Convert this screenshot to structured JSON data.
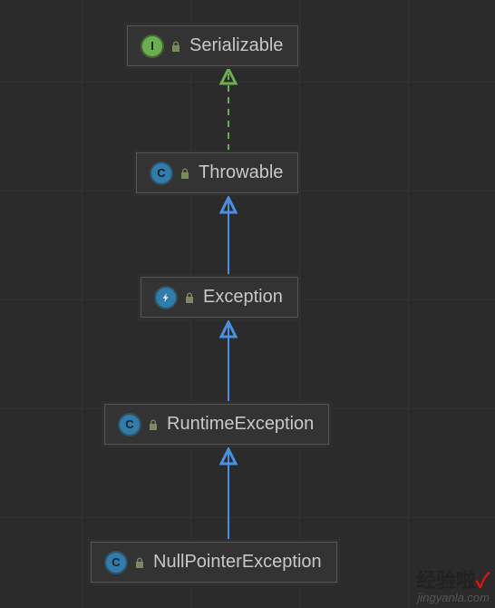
{
  "diagram": {
    "nodes": {
      "serializable": {
        "type": "interface",
        "letter": "I",
        "lock": true,
        "label": "Serializable"
      },
      "throwable": {
        "type": "class",
        "letter": "C",
        "lock": true,
        "label": "Throwable"
      },
      "exception": {
        "type": "lightning",
        "letter": "",
        "lock": true,
        "label": "Exception"
      },
      "runtimeException": {
        "type": "class",
        "letter": "C",
        "lock": true,
        "label": "RuntimeException"
      },
      "nullPointerException": {
        "type": "class",
        "letter": "C",
        "lock": true,
        "label": "NullPointerException"
      }
    },
    "edges": [
      {
        "from": "throwable",
        "to": "serializable",
        "style": "dashed",
        "color": "#6ab04c"
      },
      {
        "from": "exception",
        "to": "throwable",
        "style": "solid",
        "color": "#4a90e2"
      },
      {
        "from": "runtimeException",
        "to": "exception",
        "style": "solid",
        "color": "#4a90e2"
      },
      {
        "from": "nullPointerException",
        "to": "runtimeException",
        "style": "solid",
        "color": "#4a90e2"
      }
    ]
  },
  "watermark": {
    "line1_pre": "经验啦",
    "line1_check": "✓",
    "line2": "jingyanla.com"
  }
}
